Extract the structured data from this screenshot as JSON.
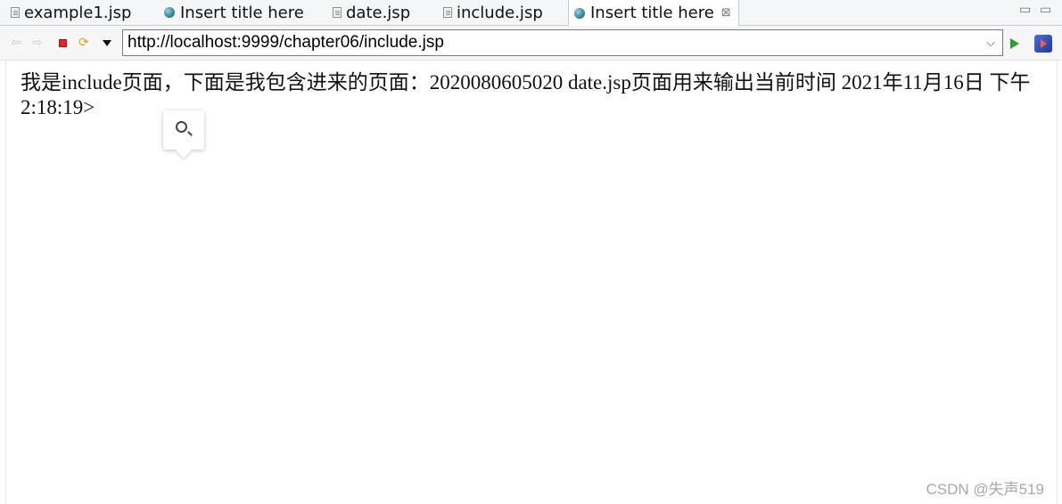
{
  "tabs": [
    {
      "label": "example1.jsp",
      "icon": "file-icon"
    },
    {
      "label": "Insert title here",
      "icon": "globe-icon"
    },
    {
      "label": "date.jsp",
      "icon": "file-icon"
    },
    {
      "label": "include.jsp",
      "icon": "file-icon"
    },
    {
      "label": "Insert title here",
      "icon": "globe-icon",
      "active": true,
      "close": "⊠"
    }
  ],
  "window_controls": {
    "minimize": "▭",
    "maximize": "▭"
  },
  "toolbar": {
    "back": "⇦",
    "forward": "⇨",
    "refresh": "⟳",
    "url": "http://localhost:9999/chapter06/include.jsp",
    "url_dropdown": "⌵"
  },
  "page": {
    "text": "我是include页面，下面是我包含进来的页面：2020080605020 date.jsp页面用来输出当前时间 2021年11月16日 下午2:18:19>"
  },
  "watermark": "CSDN @失声519",
  "colors": {
    "stop": "#e0242a",
    "go": "#2aa12a",
    "globe": "#3a8a99"
  }
}
